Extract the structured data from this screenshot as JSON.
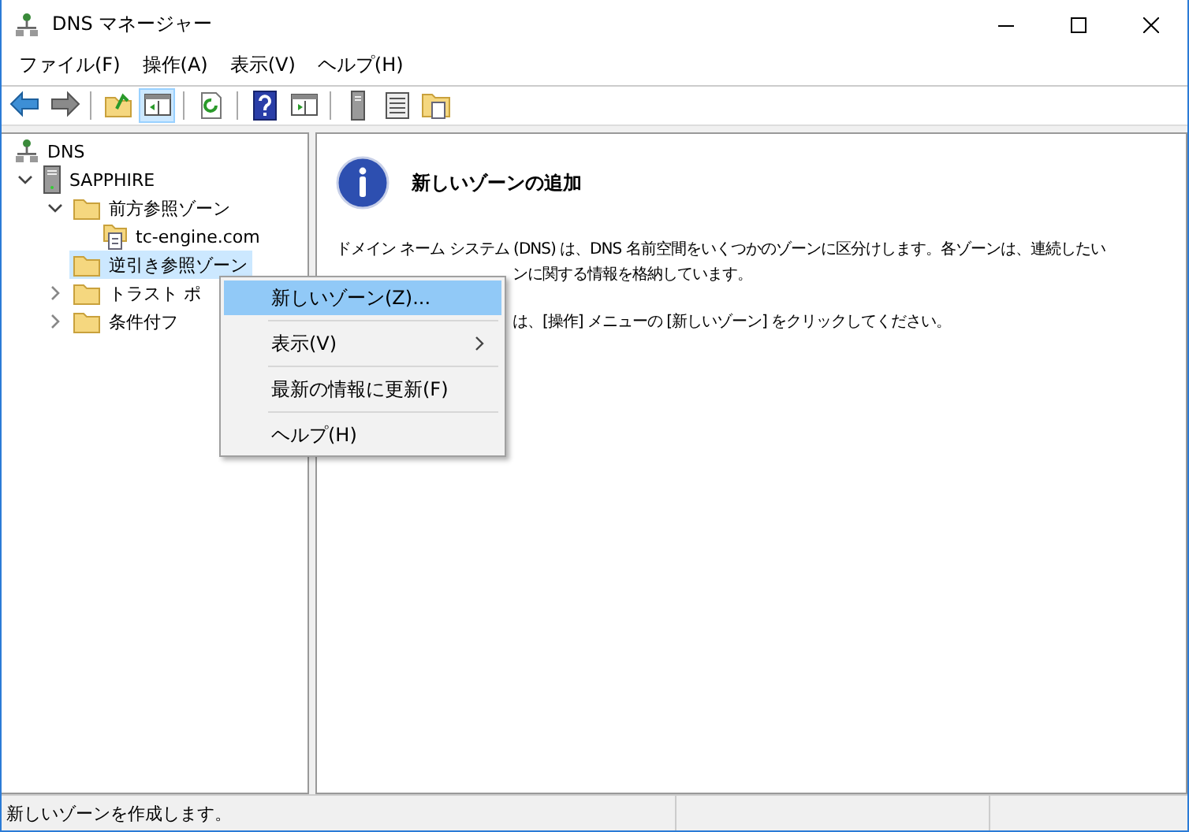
{
  "window": {
    "title": "DNS マネージャー"
  },
  "menu": [
    "ファイル(F)",
    "操作(A)",
    "表示(V)",
    "ヘルプ(H)"
  ],
  "toolbar": [
    {
      "kind": "back",
      "pressed": false
    },
    {
      "kind": "forward",
      "pressed": false
    },
    {
      "kind": "sep"
    },
    {
      "kind": "up",
      "pressed": false
    },
    {
      "kind": "tree",
      "pressed": true
    },
    {
      "kind": "sep"
    },
    {
      "kind": "refresh",
      "pressed": false
    },
    {
      "kind": "sep"
    },
    {
      "kind": "help",
      "pressed": false
    },
    {
      "kind": "pane",
      "pressed": false
    },
    {
      "kind": "sep"
    },
    {
      "kind": "server",
      "pressed": false
    },
    {
      "kind": "list",
      "pressed": false
    },
    {
      "kind": "folderdoc",
      "pressed": false
    }
  ],
  "tree": {
    "label": "DNS",
    "kind": "dns",
    "selected": false,
    "children": [
      {
        "label": "SAPPHIRE",
        "kind": "server",
        "selected": false,
        "expanded": true,
        "children": [
          {
            "label": "前方参照ゾーン",
            "kind": "folder",
            "selected": false,
            "expanded": true,
            "children": [
              {
                "label": "tc-engine.com",
                "kind": "zone",
                "selected": false
              }
            ]
          },
          {
            "label": "逆引き参照ゾーン",
            "kind": "folder",
            "selected": true
          },
          {
            "label": "トラスト ポ",
            "kind": "folder",
            "selected": false,
            "expanded": false
          },
          {
            "label": "条件付フ",
            "kind": "folder",
            "selected": false,
            "expanded": false
          }
        ]
      }
    ]
  },
  "details": {
    "heading": "新しいゾーンの追加",
    "lines": [
      {
        "text": "ドメイン ネーム システム (DNS) は、DNS 名前空間をいくつかのゾーンに区分けします。各ゾーンは、連続したい",
        "covered": false
      },
      {
        "text": "ンに関する情報を格納しています。",
        "covered": true
      },
      {
        "text": "は、[操作] メニューの [新しいゾーン] をクリックしてください。",
        "covered": true
      }
    ]
  },
  "context_menu": {
    "items": [
      {
        "label": "新しいゾーン(Z)...",
        "selected": true,
        "submenu": false
      },
      {
        "label": "表示(V)",
        "selected": false,
        "submenu": true
      },
      {
        "label": "最新の情報に更新(F)",
        "selected": false,
        "submenu": false
      },
      {
        "label": "ヘルプ(H)",
        "selected": false,
        "submenu": false
      }
    ]
  },
  "status_bar": [
    "新しいゾーンを作成します。"
  ]
}
